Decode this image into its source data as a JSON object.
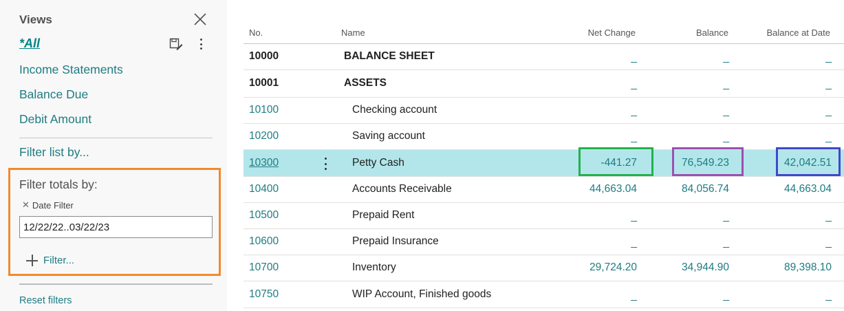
{
  "views": {
    "title": "Views",
    "all_label": "*All",
    "items": [
      "Income Statements",
      "Balance Due",
      "Debit Amount"
    ]
  },
  "filters": {
    "filter_list_label": "Filter list by...",
    "filter_totals_label": "Filter totals by:",
    "date_filter_label": "Date Filter",
    "date_filter_value": "12/22/22..03/22/23",
    "add_filter_label": "Filter...",
    "reset_label": "Reset filters"
  },
  "table": {
    "columns": [
      "No.",
      "Name",
      "Net Change",
      "Balance",
      "Balance at Date"
    ],
    "rows": [
      {
        "no": "10000",
        "name": "BALANCE SHEET",
        "net_change": "_",
        "balance": "_",
        "balance_at_date": "_"
      },
      {
        "no": "10001",
        "name": "ASSETS",
        "net_change": "_",
        "balance": "_",
        "balance_at_date": "_"
      },
      {
        "no": "10100",
        "name": "Checking account",
        "net_change": "_",
        "balance": "_",
        "balance_at_date": "_"
      },
      {
        "no": "10200",
        "name": "Saving account",
        "net_change": "_",
        "balance": "_",
        "balance_at_date": "_"
      },
      {
        "no": "10300",
        "name": "Petty Cash",
        "net_change": "-441.27",
        "balance": "76,549.23",
        "balance_at_date": "42,042.51"
      },
      {
        "no": "10400",
        "name": "Accounts Receivable",
        "net_change": "44,663.04",
        "balance": "84,056.74",
        "balance_at_date": "44,663.04"
      },
      {
        "no": "10500",
        "name": "Prepaid Rent",
        "net_change": "_",
        "balance": "_",
        "balance_at_date": "_"
      },
      {
        "no": "10600",
        "name": "Prepaid Insurance",
        "net_change": "_",
        "balance": "_",
        "balance_at_date": "_"
      },
      {
        "no": "10700",
        "name": "Inventory",
        "net_change": "29,724.20",
        "balance": "34,944.90",
        "balance_at_date": "89,398.10"
      },
      {
        "no": "10750",
        "name": "WIP Account, Finished goods",
        "net_change": "_",
        "balance": "_",
        "balance_at_date": "_"
      }
    ]
  },
  "colors": {
    "accent": "#1e7c82",
    "selected_row": "#b2e6ea",
    "filter_highlight": "#f08a2c",
    "net_change_highlight": "#22b14c",
    "balance_highlight": "#9c4fb0",
    "balance_at_date_highlight": "#3f48cc"
  },
  "icons": [
    "close-icon",
    "save-view-icon",
    "more-options-icon",
    "remove-filter-icon",
    "plus-icon",
    "row-menu-icon"
  ]
}
